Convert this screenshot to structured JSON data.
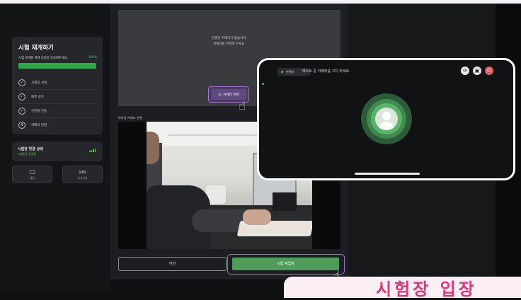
{
  "sidebar": {
    "title": "시험 재개하기",
    "subtitle": "시험 재개를 위해 설정을 완료해주세요.",
    "progress_label": "100%",
    "progress": 1.0,
    "steps": [
      {
        "label": "시험장 선택",
        "mark": "✓"
      },
      {
        "label": "화면 공유",
        "mark": "✓"
      },
      {
        "label": "신분증 인증",
        "mark": "✓"
      },
      {
        "label": "카메라 연결",
        "mark": "4"
      }
    ],
    "network": {
      "title": "시험장 연결 상태",
      "status": "시험장1 연결됨"
    },
    "buttons": [
      {
        "icon": "🖵",
        "label": "채팅"
      },
      {
        "icon": "🕬",
        "label": "공지사항"
      }
    ]
  },
  "main": {
    "camera_msg_1": "연결된 카메라가 없습니다.",
    "camera_msg_2": "카메라를 연결해 주세요.",
    "connect_button": "카메라 연결",
    "mobile_label": "모바일 카메라 연결",
    "prev_button": "이전",
    "start_button": "시험 재입장"
  },
  "phone": {
    "status": "연결됨",
    "notice": "테스트 중 카메라를 끄지 마세요."
  },
  "banner": {
    "text": "시험장 입장"
  },
  "colors": {
    "accent_green": "#4f9c5b",
    "highlight_purple": "#a66bdc",
    "banner_pink": "#e4347a"
  }
}
